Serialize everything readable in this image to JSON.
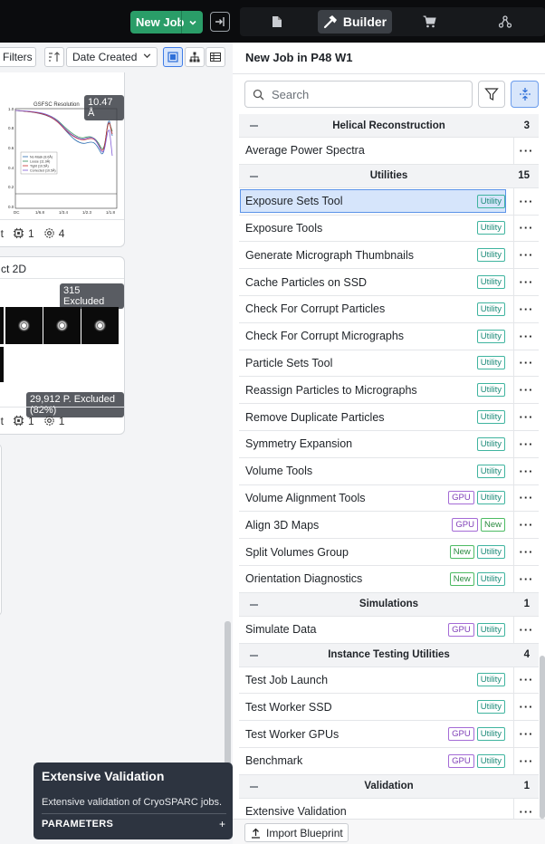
{
  "topbar": {
    "new_job_label": "New Job",
    "tabs": [
      {
        "id": "doc",
        "icon": "document-icon"
      },
      {
        "id": "builder",
        "icon": "hammer-icon",
        "label": "Builder",
        "active": true
      },
      {
        "id": "cart",
        "icon": "cart-icon"
      },
      {
        "id": "tree",
        "icon": "workflow-icon"
      }
    ]
  },
  "toolbar": {
    "filters_label": "Filters",
    "sort_label": "Date Created",
    "active_view": "cards"
  },
  "cards": [
    {
      "resolution_badge": "10.47 Å",
      "plot_title": "GSFSC Resolution",
      "plot_legend": [
        "No Mask (8.6Å)",
        "Loose (11.9Å)",
        "Tight (10.5Å)",
        "Corrected (10.5Å)"
      ],
      "footer_suffix": "lt",
      "footer_count_a": "1",
      "footer_count_b": "4"
    },
    {
      "title_suffix": "ct 2D",
      "excluded_badge": "315 Excluded",
      "particles_badge": "29,912 P. Excluded (82%)",
      "footer_suffix": "lt",
      "footer_count_a": "1",
      "footer_count_b": "1"
    }
  ],
  "tooltip": {
    "title": "Extensive Validation",
    "description": "Extensive validation of CryoSPARC jobs.",
    "params_label": "PARAMETERS",
    "expand_symbol": "+"
  },
  "panel": {
    "title": "New Job in P48 W1",
    "search_placeholder": "Search",
    "import_label": "Import Blueprint"
  },
  "job_list": [
    {
      "type": "section",
      "name": "Helical Reconstruction",
      "count": "3"
    },
    {
      "type": "job",
      "name": "Average Power Spectra",
      "tags": []
    },
    {
      "type": "section",
      "name": "Utilities",
      "count": "15"
    },
    {
      "type": "job",
      "name": "Exposure Sets Tool",
      "tags": [
        "Utility"
      ],
      "selected": true
    },
    {
      "type": "job",
      "name": "Exposure Tools",
      "tags": [
        "Utility"
      ]
    },
    {
      "type": "job",
      "name": "Generate Micrograph Thumbnails",
      "tags": [
        "Utility"
      ]
    },
    {
      "type": "job",
      "name": "Cache Particles on SSD",
      "tags": [
        "Utility"
      ]
    },
    {
      "type": "job",
      "name": "Check For Corrupt Particles",
      "tags": [
        "Utility"
      ]
    },
    {
      "type": "job",
      "name": "Check For Corrupt Micrographs",
      "tags": [
        "Utility"
      ]
    },
    {
      "type": "job",
      "name": "Particle Sets Tool",
      "tags": [
        "Utility"
      ]
    },
    {
      "type": "job",
      "name": "Reassign Particles to Micrographs",
      "tags": [
        "Utility"
      ]
    },
    {
      "type": "job",
      "name": "Remove Duplicate Particles",
      "tags": [
        "Utility"
      ]
    },
    {
      "type": "job",
      "name": "Symmetry Expansion",
      "tags": [
        "Utility"
      ]
    },
    {
      "type": "job",
      "name": "Volume Tools",
      "tags": [
        "Utility"
      ]
    },
    {
      "type": "job",
      "name": "Volume Alignment Tools",
      "tags": [
        "GPU",
        "Utility"
      ]
    },
    {
      "type": "job",
      "name": "Align 3D Maps",
      "tags": [
        "GPU",
        "New"
      ]
    },
    {
      "type": "job",
      "name": "Split Volumes Group",
      "tags": [
        "New",
        "Utility"
      ]
    },
    {
      "type": "job",
      "name": "Orientation Diagnostics",
      "tags": [
        "New",
        "Utility"
      ]
    },
    {
      "type": "section",
      "name": "Simulations",
      "count": "1"
    },
    {
      "type": "job",
      "name": "Simulate Data",
      "tags": [
        "GPU",
        "Utility"
      ]
    },
    {
      "type": "section",
      "name": "Instance Testing Utilities",
      "count": "4"
    },
    {
      "type": "job",
      "name": "Test Job Launch",
      "tags": [
        "Utility"
      ]
    },
    {
      "type": "job",
      "name": "Test Worker SSD",
      "tags": [
        "Utility"
      ]
    },
    {
      "type": "job",
      "name": "Test Worker GPUs",
      "tags": [
        "GPU",
        "Utility"
      ]
    },
    {
      "type": "job",
      "name": "Benchmark",
      "tags": [
        "GPU",
        "Utility"
      ]
    },
    {
      "type": "section",
      "name": "Validation",
      "count": "1"
    },
    {
      "type": "job",
      "name": "Extensive Validation",
      "tags": []
    }
  ],
  "more_symbol": "···",
  "colors": {
    "accent_green": "#2a9d68",
    "selected_blue": "#d6e5fb",
    "utility_tag": "#1b8a78",
    "gpu_tag": "#8040b8",
    "new_tag": "#2a8a3f"
  }
}
